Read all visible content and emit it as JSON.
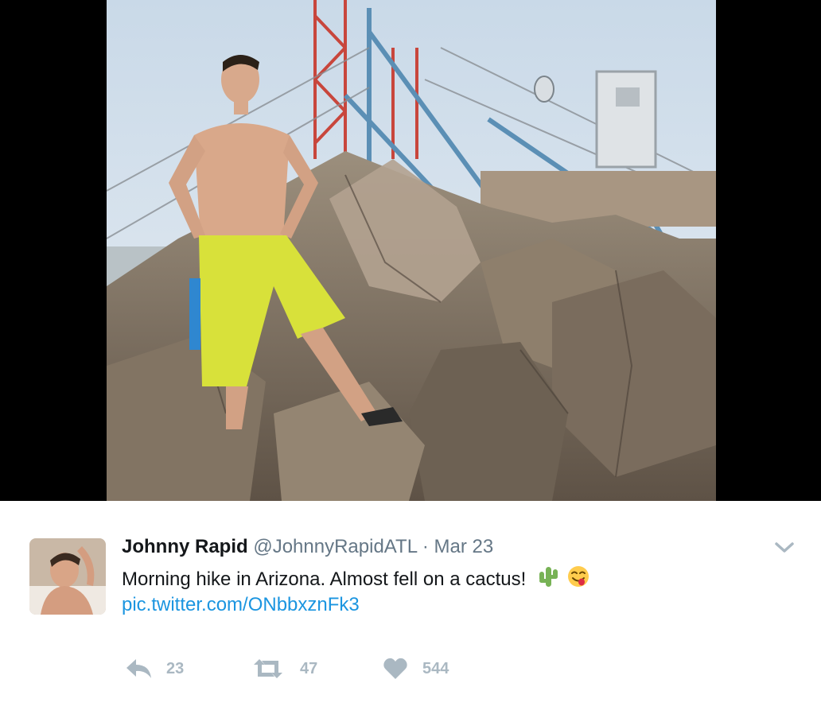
{
  "tweet": {
    "fullname": "Johnny Rapid",
    "handle": "@JohnnyRapidATL",
    "separator": "·",
    "timestamp": "Mar 23",
    "text": "Morning hike in Arizona. Almost fell on a cactus!",
    "emojis": [
      "cactus-emoji",
      "face-savoring-food-emoji"
    ],
    "link": "pic.twitter.com/ONbbxznFk3"
  },
  "actions": {
    "reply_icon": "reply-icon",
    "reply_count": "23",
    "retweet_icon": "retweet-icon",
    "retweet_count": "47",
    "like_icon": "heart-icon",
    "like_count": "544"
  },
  "menu": {
    "icon": "chevron-down-icon"
  },
  "colors": {
    "link": "#1b95e0",
    "secondary_text": "#657786",
    "action_gray": "#aab8c2",
    "primary_text": "#14171a"
  }
}
